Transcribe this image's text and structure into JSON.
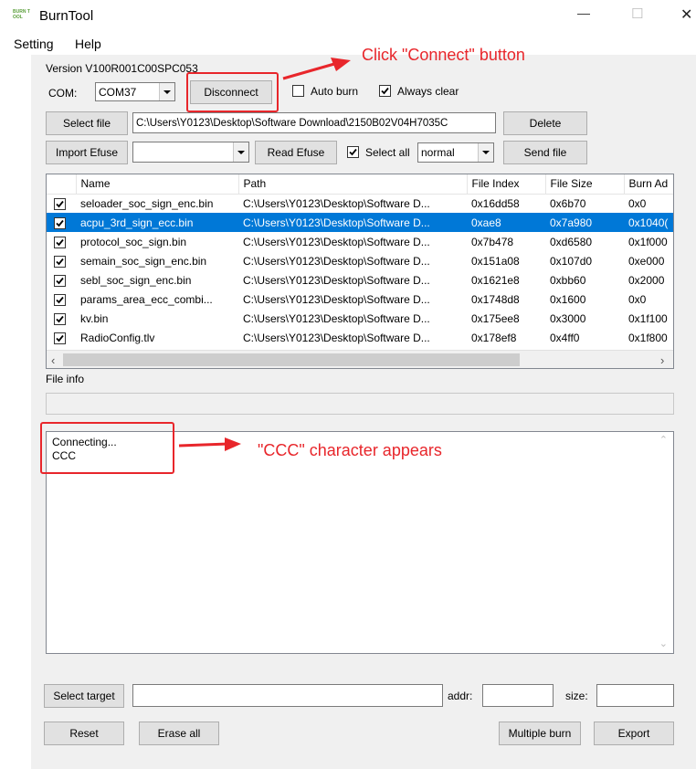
{
  "window": {
    "app_icon_text": "BURN TOOL",
    "title": "BurnTool",
    "minimize_glyph": "—",
    "maximize_glyph": "☐",
    "close_glyph": "✕"
  },
  "menu": {
    "items": [
      "Setting",
      "Help"
    ]
  },
  "version": "Version V100R001C00SPC053",
  "com": {
    "label": "COM:",
    "value": "COM37"
  },
  "buttons": {
    "disconnect": "Disconnect",
    "select_file": "Select file",
    "delete": "Delete",
    "import_efuse": "Import Efuse",
    "read_efuse": "Read Efuse",
    "send_file": "Send file",
    "select_target": "Select target",
    "reset": "Reset",
    "erase_all": "Erase all",
    "multiple_burn": "Multiple burn",
    "export": "Export"
  },
  "options": {
    "auto_burn": {
      "label": "Auto burn",
      "checked": false
    },
    "always_clear": {
      "label": "Always clear",
      "checked": true
    },
    "select_all": {
      "label": "Select all",
      "checked": true
    }
  },
  "file_path": "C:\\Users\\Y0123\\Desktop\\Software Download\\2150B02V04H7035C",
  "import_efuse_combo": "",
  "mode_combo": "normal",
  "table": {
    "columns": [
      "Name",
      "Path",
      "File Index",
      "File Size",
      "Burn Ad"
    ],
    "rows": [
      {
        "checked": true,
        "name": "seloader_soc_sign_enc.bin",
        "path": "C:\\Users\\Y0123\\Desktop\\Software D...",
        "index": "0x16dd58",
        "size": "0x6b70",
        "burn": "0x0",
        "selected": false
      },
      {
        "checked": true,
        "name": "acpu_3rd_sign_ecc.bin",
        "path": "C:\\Users\\Y0123\\Desktop\\Software D...",
        "index": "0xae8",
        "size": "0x7a980",
        "burn": "0x1040(",
        "selected": true
      },
      {
        "checked": true,
        "name": "protocol_soc_sign.bin",
        "path": "C:\\Users\\Y0123\\Desktop\\Software D...",
        "index": "0x7b478",
        "size": "0xd6580",
        "burn": "0x1f000",
        "selected": false
      },
      {
        "checked": true,
        "name": "semain_soc_sign_enc.bin",
        "path": "C:\\Users\\Y0123\\Desktop\\Software D...",
        "index": "0x151a08",
        "size": "0x107d0",
        "burn": "0xe000",
        "selected": false
      },
      {
        "checked": true,
        "name": "sebl_soc_sign_enc.bin",
        "path": "C:\\Users\\Y0123\\Desktop\\Software D...",
        "index": "0x1621e8",
        "size": "0xbb60",
        "burn": "0x2000",
        "selected": false
      },
      {
        "checked": true,
        "name": "params_area_ecc_combi...",
        "path": "C:\\Users\\Y0123\\Desktop\\Software D...",
        "index": "0x1748d8",
        "size": "0x1600",
        "burn": "0x0",
        "selected": false
      },
      {
        "checked": true,
        "name": "kv.bin",
        "path": "C:\\Users\\Y0123\\Desktop\\Software D...",
        "index": "0x175ee8",
        "size": "0x3000",
        "burn": "0x1f100",
        "selected": false
      },
      {
        "checked": true,
        "name": "RadioConfig.tlv",
        "path": "C:\\Users\\Y0123\\Desktop\\Software D...",
        "index": "0x178ef8",
        "size": "0x4ff0",
        "burn": "0x1f800",
        "selected": false
      }
    ]
  },
  "file_info": {
    "label": "File info",
    "value": ""
  },
  "log": {
    "lines": [
      "Connecting...",
      "CCC"
    ]
  },
  "target": {
    "value": "",
    "addr_label": "addr:",
    "addr_value": "",
    "size_label": "size:",
    "size_value": ""
  },
  "annotations": {
    "connect": "Click \"Connect\" button",
    "ccc": "\"CCC\" character appears"
  },
  "colors": {
    "accent_red": "#e8262b",
    "selection_blue": "#0078d7"
  },
  "icons": [
    "checkmark-icon",
    "chevron-down-icon",
    "chevron-left-icon",
    "chevron-right-icon",
    "chevron-up-icon",
    "red-arrow-icon"
  ]
}
